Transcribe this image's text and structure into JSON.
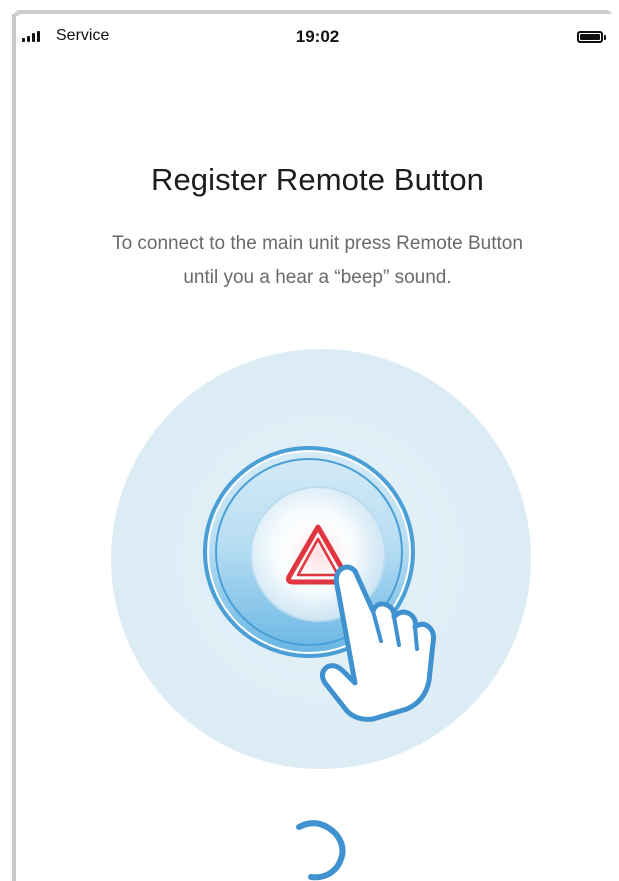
{
  "status_bar": {
    "carrier": "Service",
    "time": "19:02",
    "signal_bars": 4,
    "battery_level": 1.0
  },
  "page": {
    "title": "Register Remote Button",
    "subtitle_line1": "To connect to the main unit press Remote Button",
    "subtitle_line2": "until you a hear a “beep” sound."
  },
  "illustration": {
    "icon": "press-remote-button-illustration",
    "background_color": "#e3f0f7",
    "button_ring_color": "#4a9fd6",
    "warning_triangle_color": "#e0363f"
  },
  "loading": {
    "icon": "loading-spinner-icon",
    "color": "#3f92cf"
  }
}
